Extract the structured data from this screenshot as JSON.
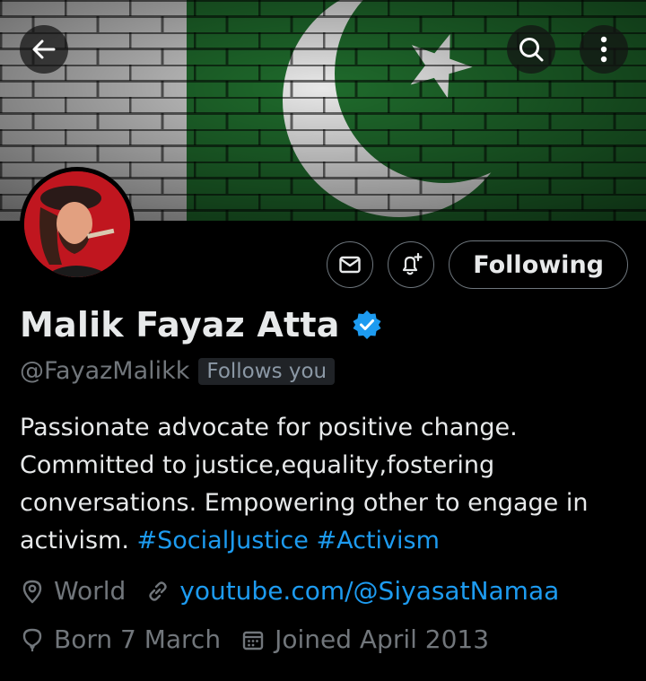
{
  "profile": {
    "name": "Malik Fayaz Atta",
    "handle": "@FayazMalikk",
    "follows_you": "Follows you",
    "bio_text": "Passionate advocate for positive change. Committed to justice,equality,fostering conversations. Empowering other to engage in activism.",
    "hashtags": [
      "#SocialJustice",
      "#Activism"
    ],
    "location": "World",
    "website": "youtube.com/@SiyasatNamaa",
    "birthday": "Born 7 March",
    "joined": "Joined April 2013"
  },
  "actions": {
    "following_label": "Following"
  },
  "icons": {
    "back": "arrow-left-icon",
    "search": "search-icon",
    "more": "more-vertical-icon",
    "message": "mail-icon",
    "notify": "bell-plus-icon",
    "verified": "verified-badge-icon",
    "location": "location-pin-icon",
    "link": "link-icon",
    "birthday": "balloon-icon",
    "calendar": "calendar-icon"
  },
  "colors": {
    "background": "#000000",
    "accent": "#1d9bf0",
    "muted": "#71767b",
    "flag_green": "#1f6b2c"
  }
}
